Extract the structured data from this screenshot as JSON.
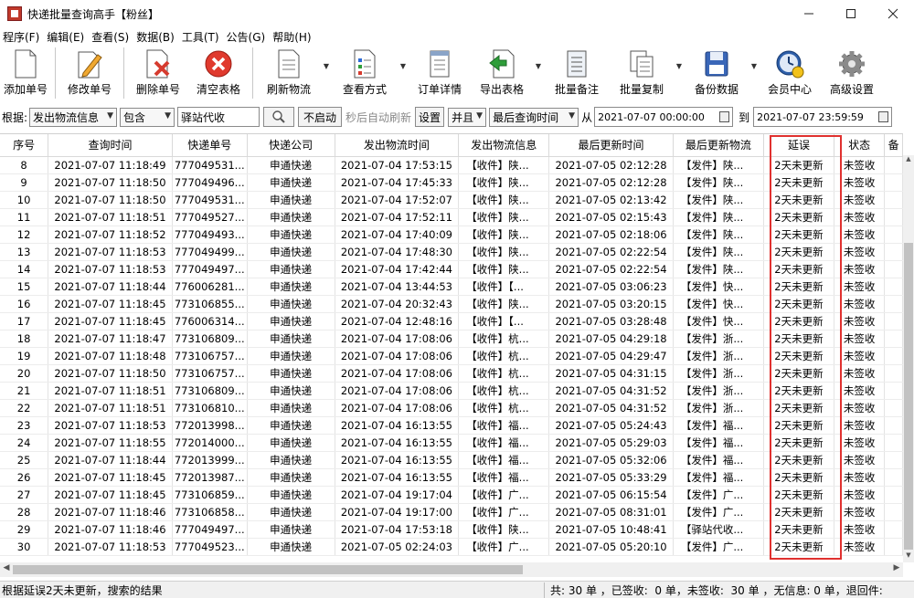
{
  "window": {
    "title": "快递批量查询高手【粉丝】"
  },
  "menu": [
    "程序(F)",
    "编辑(E)",
    "查看(S)",
    "数据(B)",
    "工具(T)",
    "公告(G)",
    "帮助(H)"
  ],
  "toolbar": [
    {
      "label": "添加单号",
      "icon": "document-icon"
    },
    {
      "label": "修改单号",
      "icon": "pencil-document-icon"
    },
    {
      "label": "删除单号",
      "icon": "delete-document-icon"
    },
    {
      "label": "清空表格",
      "icon": "clear-icon"
    },
    {
      "label": "刷新物流",
      "icon": "refresh-document-icon"
    },
    {
      "label": "查看方式",
      "icon": "view-mode-icon"
    },
    {
      "label": "订单详情",
      "icon": "order-detail-icon"
    },
    {
      "label": "导出表格",
      "icon": "export-icon"
    },
    {
      "label": "批量备注",
      "icon": "note-icon"
    },
    {
      "label": "批量复制",
      "icon": "copy-icon"
    },
    {
      "label": "备份数据",
      "icon": "floppy-icon"
    },
    {
      "label": "会员中心",
      "icon": "clock-user-icon"
    },
    {
      "label": "高级设置",
      "icon": "gear-icon"
    }
  ],
  "search": {
    "by_label": "根据:",
    "field": "发出物流信息",
    "match": "包含",
    "keyword": "驿站代收",
    "auto_refresh_button": "不启动",
    "auto_refresh_text": "秒后自动刷新",
    "settings_button": "设置",
    "logic": "并且",
    "time_field": "最后查询时间",
    "from_label": "从",
    "from": "2021-07-07 00:00:00",
    "to_label": "到",
    "to": "2021-07-07 23:59:59"
  },
  "table": {
    "columns": [
      "序号",
      "查询时间",
      "快递单号",
      "快递公司",
      "发出物流时间",
      "发出物流信息",
      "最后更新时间",
      "最后更新物流",
      "延误",
      "状态",
      "备"
    ],
    "rows": [
      [
        "8",
        "2021-07-07 11:18:49",
        "777049531...",
        "申通快递",
        "2021-07-04 17:53:15",
        "【收件】陕...",
        "2021-07-05 02:12:28",
        "【发件】陕...",
        "2天未更新",
        "未签收"
      ],
      [
        "9",
        "2021-07-07 11:18:50",
        "777049496...",
        "申通快递",
        "2021-07-04 17:45:33",
        "【收件】陕...",
        "2021-07-05 02:12:28",
        "【发件】陕...",
        "2天未更新",
        "未签收"
      ],
      [
        "10",
        "2021-07-07 11:18:50",
        "777049531...",
        "申通快递",
        "2021-07-04 17:52:07",
        "【收件】陕...",
        "2021-07-05 02:13:42",
        "【发件】陕...",
        "2天未更新",
        "未签收"
      ],
      [
        "11",
        "2021-07-07 11:18:51",
        "777049527...",
        "申通快递",
        "2021-07-04 17:52:11",
        "【收件】陕...",
        "2021-07-05 02:15:43",
        "【发件】陕...",
        "2天未更新",
        "未签收"
      ],
      [
        "12",
        "2021-07-07 11:18:52",
        "777049493...",
        "申通快递",
        "2021-07-04 17:40:09",
        "【收件】陕...",
        "2021-07-05 02:18:06",
        "【发件】陕...",
        "2天未更新",
        "未签收"
      ],
      [
        "13",
        "2021-07-07 11:18:53",
        "777049499...",
        "申通快递",
        "2021-07-04 17:48:30",
        "【收件】陕...",
        "2021-07-05 02:22:54",
        "【发件】陕...",
        "2天未更新",
        "未签收"
      ],
      [
        "14",
        "2021-07-07 11:18:53",
        "777049497...",
        "申通快递",
        "2021-07-04 17:42:44",
        "【收件】陕...",
        "2021-07-05 02:22:54",
        "【发件】陕...",
        "2天未更新",
        "未签收"
      ],
      [
        "15",
        "2021-07-07 11:18:44",
        "776006281...",
        "申通快递",
        "2021-07-04 13:44:53",
        "【收件】【...",
        "2021-07-05 03:06:23",
        "【发件】快...",
        "2天未更新",
        "未签收"
      ],
      [
        "16",
        "2021-07-07 11:18:45",
        "773106855...",
        "申通快递",
        "2021-07-04 20:32:43",
        "【收件】陕...",
        "2021-07-05 03:20:15",
        "【发件】快...",
        "2天未更新",
        "未签收"
      ],
      [
        "17",
        "2021-07-07 11:18:45",
        "776006314...",
        "申通快递",
        "2021-07-04 12:48:16",
        "【收件】【...",
        "2021-07-05 03:28:48",
        "【发件】快...",
        "2天未更新",
        "未签收"
      ],
      [
        "18",
        "2021-07-07 11:18:47",
        "773106809...",
        "申通快递",
        "2021-07-04 17:08:06",
        "【收件】杭...",
        "2021-07-05 04:29:18",
        "【发件】浙...",
        "2天未更新",
        "未签收"
      ],
      [
        "19",
        "2021-07-07 11:18:48",
        "773106757...",
        "申通快递",
        "2021-07-04 17:08:06",
        "【收件】杭...",
        "2021-07-05 04:29:47",
        "【发件】浙...",
        "2天未更新",
        "未签收"
      ],
      [
        "20",
        "2021-07-07 11:18:50",
        "773106757...",
        "申通快递",
        "2021-07-04 17:08:06",
        "【收件】杭...",
        "2021-07-05 04:31:15",
        "【发件】浙...",
        "2天未更新",
        "未签收"
      ],
      [
        "21",
        "2021-07-07 11:18:51",
        "773106809...",
        "申通快递",
        "2021-07-04 17:08:06",
        "【收件】杭...",
        "2021-07-05 04:31:52",
        "【发件】浙...",
        "2天未更新",
        "未签收"
      ],
      [
        "22",
        "2021-07-07 11:18:51",
        "773106810...",
        "申通快递",
        "2021-07-04 17:08:06",
        "【收件】杭...",
        "2021-07-05 04:31:52",
        "【发件】浙...",
        "2天未更新",
        "未签收"
      ],
      [
        "23",
        "2021-07-07 11:18:53",
        "772013998...",
        "申通快递",
        "2021-07-04 16:13:55",
        "【收件】福...",
        "2021-07-05 05:24:43",
        "【发件】福...",
        "2天未更新",
        "未签收"
      ],
      [
        "24",
        "2021-07-07 11:18:55",
        "772014000...",
        "申通快递",
        "2021-07-04 16:13:55",
        "【收件】福...",
        "2021-07-05 05:29:03",
        "【发件】福...",
        "2天未更新",
        "未签收"
      ],
      [
        "25",
        "2021-07-07 11:18:44",
        "772013999...",
        "申通快递",
        "2021-07-04 16:13:55",
        "【收件】福...",
        "2021-07-05 05:32:06",
        "【发件】福...",
        "2天未更新",
        "未签收"
      ],
      [
        "26",
        "2021-07-07 11:18:45",
        "772013987...",
        "申通快递",
        "2021-07-04 16:13:55",
        "【收件】福...",
        "2021-07-05 05:33:29",
        "【发件】福...",
        "2天未更新",
        "未签收"
      ],
      [
        "27",
        "2021-07-07 11:18:45",
        "773106859...",
        "申通快递",
        "2021-07-04 19:17:04",
        "【收件】广...",
        "2021-07-05 06:15:54",
        "【发件】广...",
        "2天未更新",
        "未签收"
      ],
      [
        "28",
        "2021-07-07 11:18:46",
        "773106858...",
        "申通快递",
        "2021-07-04 19:17:00",
        "【收件】广...",
        "2021-07-05 08:31:01",
        "【发件】广...",
        "2天未更新",
        "未签收"
      ],
      [
        "29",
        "2021-07-07 11:18:46",
        "777049497...",
        "申通快递",
        "2021-07-04 17:53:18",
        "【收件】陕...",
        "2021-07-05 10:48:41",
        "【驿站代收...",
        "2天未更新",
        "未签收"
      ],
      [
        "30",
        "2021-07-07 11:18:53",
        "777049523...",
        "申通快递",
        "2021-07-05 02:24:03",
        "【收件】广...",
        "2021-07-05 05:20:10",
        "【发件】广...",
        "2天未更新",
        "未签收"
      ]
    ]
  },
  "status": {
    "left": "根据延误2天未更新，搜索的结果",
    "right": "共: 30 单 ，已签收:  0 单，未签收:  30 单 ，无信息: 0 单，退回件:"
  },
  "colors": {
    "highlight_border": "#e0312f",
    "delete_red": "#d63b2f",
    "export_green": "#2e9e3a"
  }
}
